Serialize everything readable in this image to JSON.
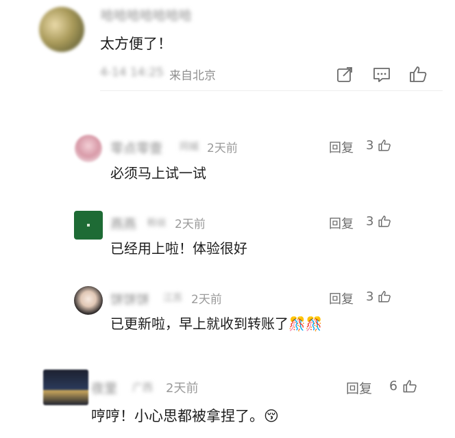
{
  "main_comment": {
    "username": "哈哈哈哈哈哈哈",
    "text": "太方便了！",
    "date": "4-14 14:25",
    "location": "来自北京",
    "actions": {
      "share_icon": "share-icon",
      "comment_icon": "comment-icon",
      "like_icon": "thumbs-up-icon"
    }
  },
  "replies": [
    {
      "username": "零点零壹",
      "badge": "同城",
      "time": "2天前",
      "text": "必须马上试一试",
      "reply_label": "回复",
      "likes": "3"
    },
    {
      "username": "燕燕",
      "badge": "粉丝",
      "time": "2天前",
      "text": "已经用上啦！体验很好",
      "reply_label": "回复",
      "likes": "3"
    },
    {
      "username": "饼饼饼",
      "badge": "江苏",
      "time": "2天前",
      "text": "已更新啦，早上就收到转账了🎊🎊",
      "reply_label": "回复",
      "likes": "3"
    }
  ],
  "last_comment": {
    "username": "夜里",
    "location_tag": "广西",
    "time": "2天前",
    "text": "哼哼！小心思都被拿捏了。😚",
    "reply_label": "回复",
    "likes": "6"
  }
}
